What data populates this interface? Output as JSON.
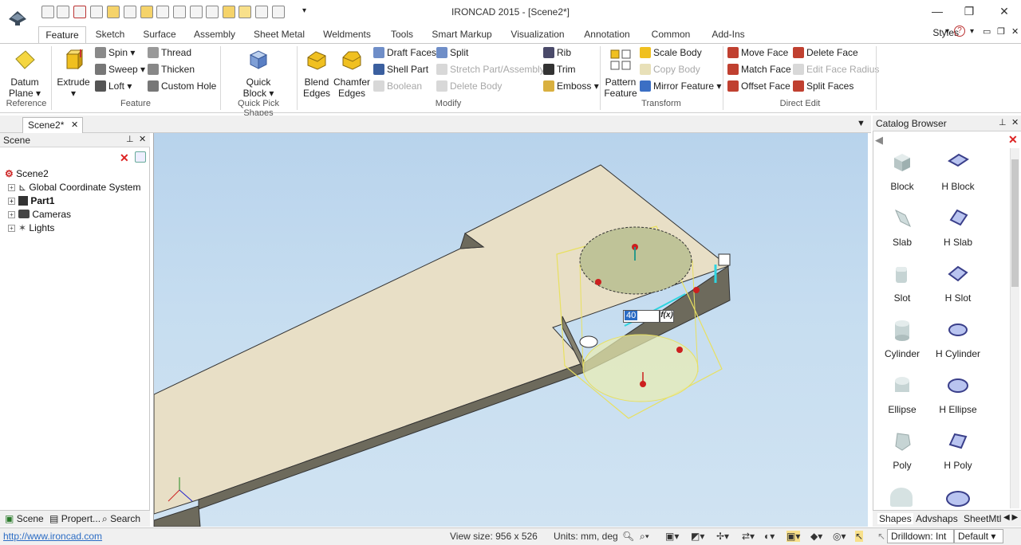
{
  "window": {
    "title": "IRONCAD 2015 - [Scene2*]"
  },
  "tabs": [
    "Feature",
    "Sketch",
    "Surface",
    "Assembly",
    "Sheet Metal",
    "Weldments",
    "Tools",
    "Smart Markup",
    "Visualization",
    "Annotation",
    "Common",
    "Add-Ins"
  ],
  "styles_label": "Styles",
  "ribbon": {
    "reference": {
      "label": "Reference",
      "datum_line1": "Datum",
      "datum_line2": "Plane"
    },
    "feature": {
      "label": "Feature",
      "extrude": "Extrude",
      "spin": "Spin",
      "sweep": "Sweep",
      "loft": "Loft",
      "thread": "Thread",
      "thicken": "Thicken",
      "custom_hole": "Custom Hole"
    },
    "quick_pick": {
      "label": "Quick Pick Shapes",
      "line1": "Quick",
      "line2": "Block"
    },
    "modify": {
      "label": "Modify",
      "blend_line1": "Blend",
      "blend_line2": "Edges",
      "chamfer_line1": "Chamfer",
      "chamfer_line2": "Edges",
      "draft_faces": "Draft Faces",
      "shell_part": "Shell Part",
      "boolean": "Boolean",
      "split": "Split",
      "stretch": "Stretch Part/Assembly",
      "delete_body": "Delete Body",
      "rib": "Rib",
      "trim": "Trim",
      "emboss": "Emboss"
    },
    "transform": {
      "label": "Transform",
      "pattern_line1": "Pattern",
      "pattern_line2": "Feature",
      "scale_body": "Scale Body",
      "copy_body": "Copy Body",
      "mirror_feature": "Mirror Feature"
    },
    "direct_edit": {
      "label": "Direct Edit",
      "move_face": "Move Face",
      "match_face": "Match Face",
      "offset_face": "Offset Face",
      "delete_face": "Delete Face",
      "edit_face_radius": "Edit Face Radius",
      "split_faces": "Split Faces"
    }
  },
  "document_tab": "Scene2*",
  "scene_panel": {
    "title": "Scene",
    "tree": [
      "Scene2",
      "Global Coordinate System",
      "Part1",
      "Cameras",
      "Lights"
    ],
    "bottom_tabs": [
      "Scene",
      "Propert...",
      "Search"
    ]
  },
  "viewport": {
    "dimension_value": "40",
    "fx_label": "f(x)"
  },
  "catalog": {
    "title": "Catalog Browser",
    "items": [
      [
        "Block",
        "H Block"
      ],
      [
        "Slab",
        "H Slab"
      ],
      [
        "Slot",
        "H Slot"
      ],
      [
        "Cylinder",
        "H Cylinder"
      ],
      [
        "Ellipse",
        "H Ellipse"
      ],
      [
        "Poly",
        "H Poly"
      ]
    ],
    "bottom_tabs": [
      "Shapes",
      "Advshaps",
      "SheetMtl"
    ]
  },
  "status": {
    "url": "http://www.ironcad.com",
    "view_size": "View size:  956 x  526",
    "units": "Units: mm, deg",
    "drilldown": "Drilldown: Int",
    "style": "Default"
  },
  "colors": {
    "accent": "#2b6cc4",
    "body_top": "#e8dfc6",
    "body_side": "#6d6a5c",
    "highlight": "#f2f07a"
  }
}
